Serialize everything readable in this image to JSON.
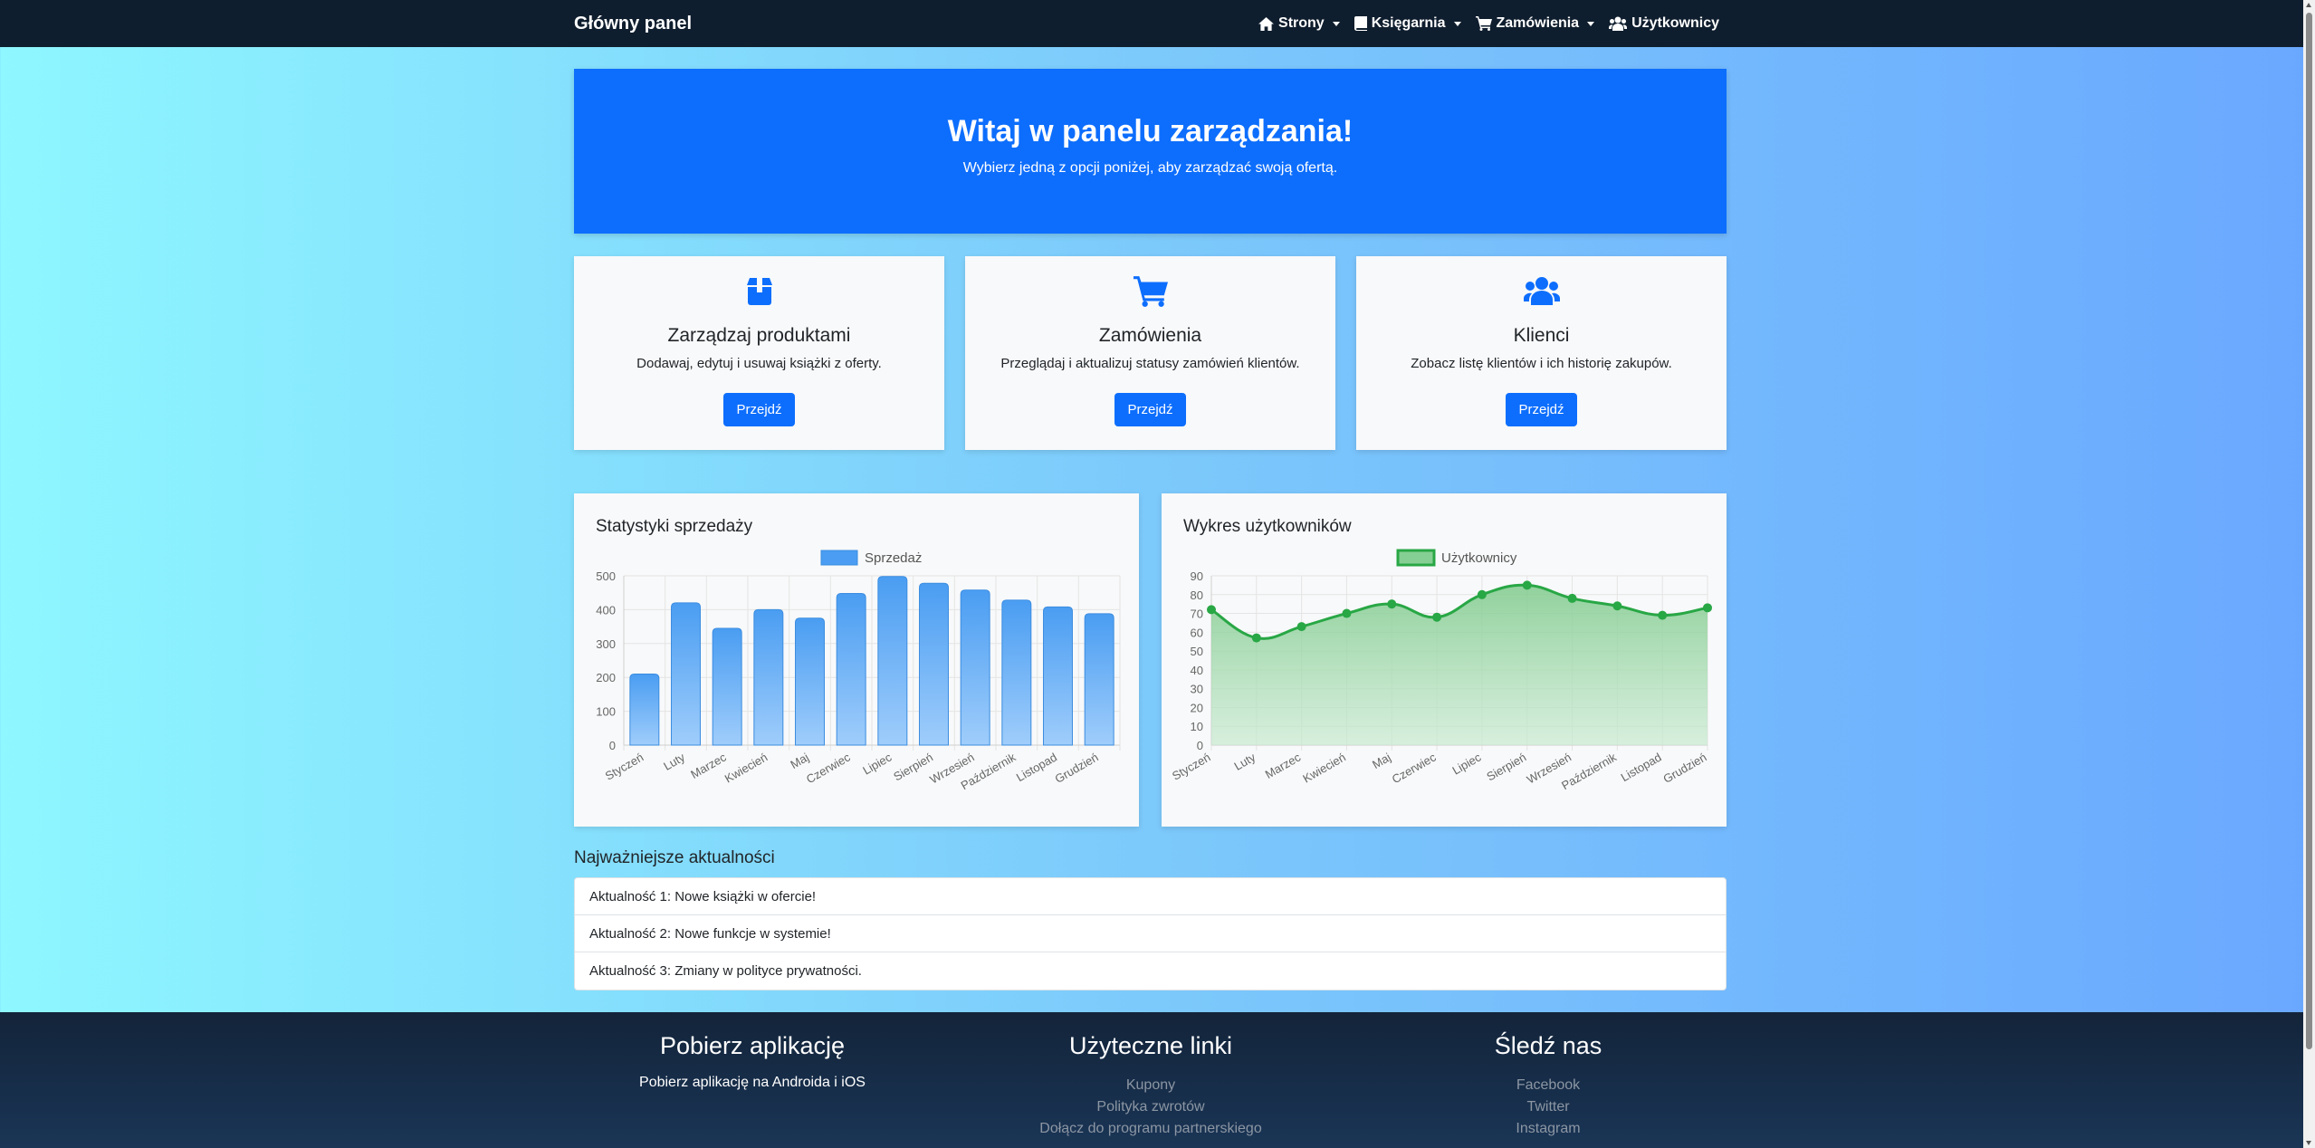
{
  "navbar": {
    "brand": "Główny panel",
    "items": [
      {
        "label": "Strony",
        "icon": "home-icon",
        "dropdown": true
      },
      {
        "label": "Księgarnia",
        "icon": "book-icon",
        "dropdown": true
      },
      {
        "label": "Zamówienia",
        "icon": "cart-icon",
        "dropdown": true
      },
      {
        "label": "Użytkownicy",
        "icon": "users-icon",
        "dropdown": false
      }
    ]
  },
  "hero": {
    "title": "Witaj w panelu zarządzania!",
    "subtitle": "Wybierz jedną z opcji poniżej, aby zarządzać swoją ofertą."
  },
  "cards": [
    {
      "icon": "box-icon",
      "title": "Zarządzaj produktami",
      "text": "Dodawaj, edytuj i usuwaj książki z oferty.",
      "button": "Przejdź"
    },
    {
      "icon": "cart-icon",
      "title": "Zamówienia",
      "text": "Przeglądaj i aktualizuj statusy zamówień klientów.",
      "button": "Przejdź"
    },
    {
      "icon": "users-icon",
      "title": "Klienci",
      "text": "Zobacz listę klientów i ich historię zakupów.",
      "button": "Przejdź"
    }
  ],
  "colors": {
    "primary": "#0d6efd",
    "bar_fill": "#5ba8f5",
    "line": "#28a745",
    "navbar": "#0f1e2e"
  },
  "chart_data": [
    {
      "type": "bar",
      "title": "Statystyki sprzedaży",
      "categories": [
        "Styczeń",
        "Luty",
        "Marzec",
        "Kwiecień",
        "Maj",
        "Czerwiec",
        "Lipiec",
        "Sierpień",
        "Wrzesień",
        "Październik",
        "Listopad",
        "Grudzień"
      ],
      "series": [
        {
          "name": "Sprzedaż",
          "values": [
            210,
            420,
            345,
            400,
            375,
            448,
            498,
            478,
            458,
            428,
            408,
            388
          ]
        }
      ],
      "ylim": [
        0,
        500
      ],
      "yticks": [
        0,
        100,
        200,
        300,
        400,
        500
      ],
      "grid": true,
      "legend": "top"
    },
    {
      "type": "area",
      "title": "Wykres użytkowników",
      "categories": [
        "Styczeń",
        "Luty",
        "Marzec",
        "Kwiecień",
        "Maj",
        "Czerwiec",
        "Lipiec",
        "Sierpień",
        "Wrzesień",
        "Październik",
        "Listopad",
        "Grudzień"
      ],
      "series": [
        {
          "name": "Użytkownicy",
          "values": [
            72,
            57,
            63,
            70,
            75,
            68,
            80,
            85,
            78,
            74,
            69,
            73
          ]
        }
      ],
      "ylim": [
        0,
        90
      ],
      "yticks": [
        0,
        10,
        20,
        30,
        40,
        50,
        60,
        70,
        80,
        90
      ],
      "grid": true,
      "legend": "top"
    }
  ],
  "news": {
    "title": "Najważniejsze aktualności",
    "items": [
      "Aktualność 1: Nowe książki w ofercie!",
      "Aktualność 2: Nowe funkcje w systemie!",
      "Aktualność 3: Zmiany w polityce prywatności."
    ]
  },
  "footer": {
    "app": {
      "title": "Pobierz aplikację",
      "text": "Pobierz aplikację na Androida i iOS"
    },
    "links": {
      "title": "Użyteczne linki",
      "items": [
        "Kupony",
        "Polityka zwrotów",
        "Dołącz do programu partnerskiego"
      ]
    },
    "follow": {
      "title": "Śledź nas",
      "items": [
        "Facebook",
        "Twitter",
        "Instagram"
      ]
    }
  }
}
